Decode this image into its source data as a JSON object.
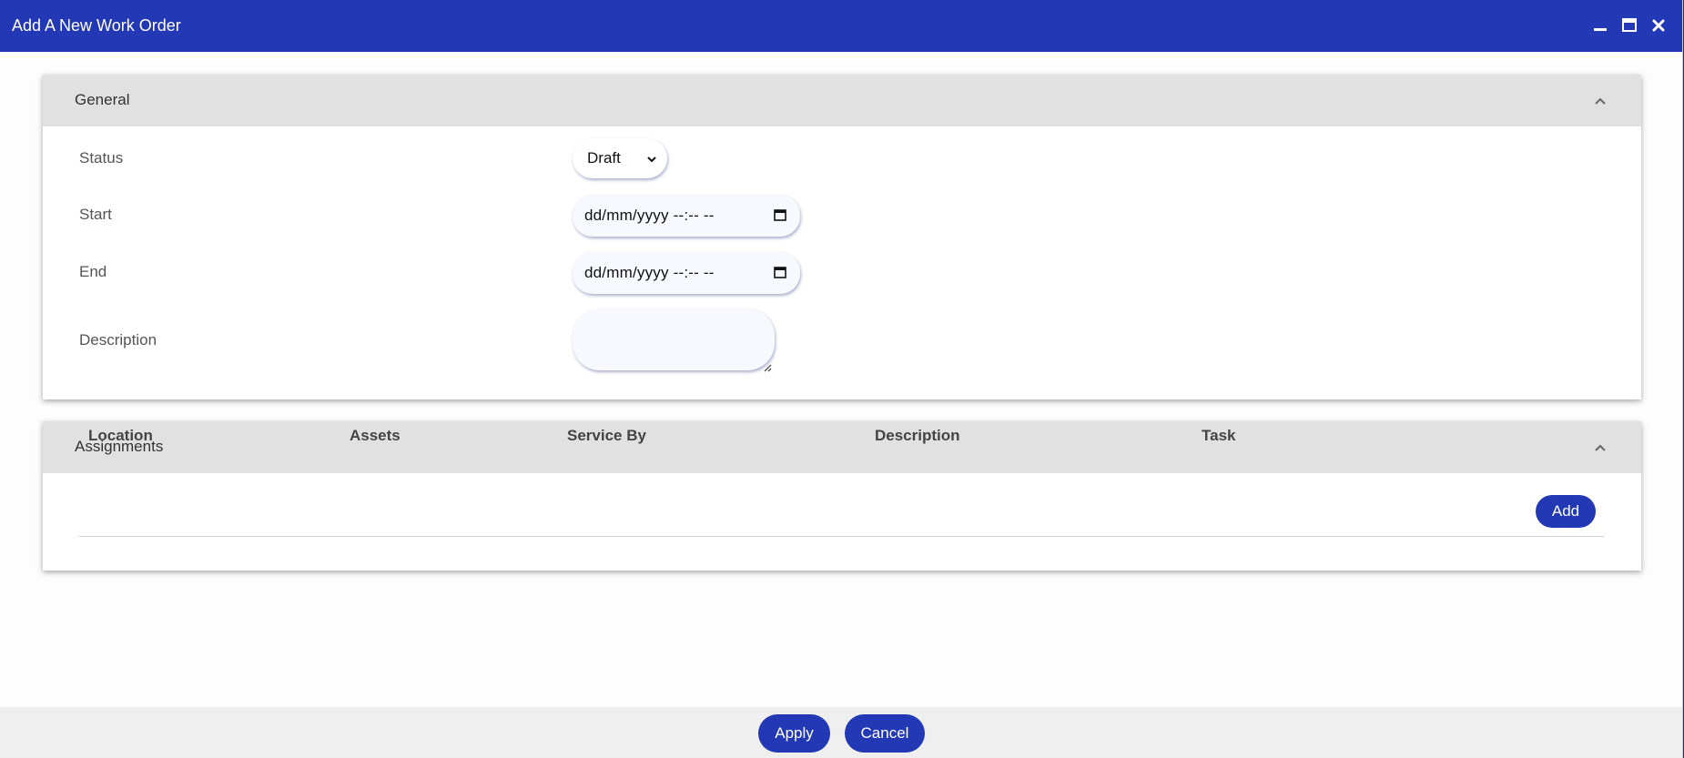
{
  "window": {
    "title": "Add A New Work Order",
    "controls": [
      "minimize-icon",
      "maximize-icon",
      "close-icon"
    ]
  },
  "general": {
    "title": "General",
    "collapse_icon": "chevron-up-icon",
    "status_label": "Status",
    "status_value": "Draft",
    "start_label": "Start",
    "start_value": "dd/mm/yyyy --:-- --",
    "end_label": "End",
    "end_value": "dd/mm/yyyy --:-- --",
    "description_label": "Description",
    "description_value": ""
  },
  "assignments": {
    "title": "Assignments",
    "collapse_icon": "chevron-up-icon",
    "columns": [
      "Location",
      "Assets",
      "Service By",
      "Description",
      "Task"
    ],
    "add_label": "Add",
    "rows": []
  },
  "footer": {
    "apply_label": "Apply",
    "cancel_label": "Cancel"
  },
  "colors": {
    "accent": "#2338b5",
    "panel_header": "#e2e1e2",
    "footer_bg": "#efefef"
  }
}
